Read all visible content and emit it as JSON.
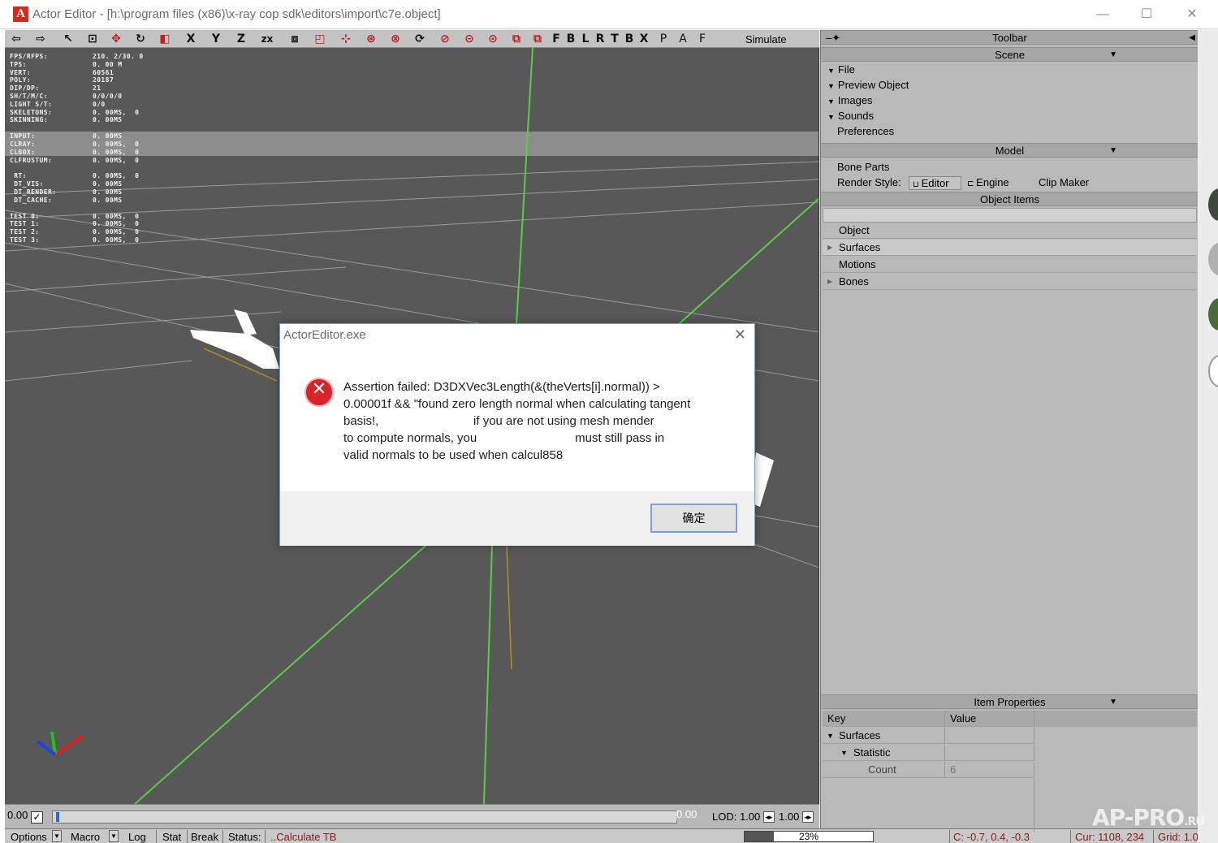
{
  "window": {
    "app_icon": "A",
    "title": "Actor Editor - [h:\\program files (x86)\\x-ray cop sdk\\editors\\import\\c7e.object]",
    "minimize": "—",
    "maximize": "☐",
    "close": "✕"
  },
  "toolbar": {
    "letters": [
      "X",
      "Y",
      "Z",
      "zx"
    ],
    "views": [
      "F",
      "B",
      "L",
      "R",
      "T",
      "B",
      "X",
      "P",
      "A",
      "F"
    ],
    "simulate": "Simulate"
  },
  "stats": [
    {
      "k": "FPS/RFPS:",
      "v": "210. 2/30. 0"
    },
    {
      "k": "TPS:",
      "v": "0. 00 M"
    },
    {
      "k": "VERT:",
      "v": "60561"
    },
    {
      "k": "POLY:",
      "v": "20187"
    },
    {
      "k": "DIP/DP:",
      "v": "21"
    },
    {
      "k": "SH/T/M/C:",
      "v": "0/0/0/0"
    },
    {
      "k": "LIGHT S/T:",
      "v": "0/0"
    },
    {
      "k": "SKELETONS:",
      "v": "0. 00MS,  0"
    },
    {
      "k": "SKINNING:",
      "v": "0. 00MS"
    },
    {
      "k": "",
      "v": "",
      "gap": true
    },
    {
      "k": "INPUT:",
      "v": "0. 00MS"
    },
    {
      "k": "CLRAY:",
      "v": "0. 00MS,  0"
    },
    {
      "k": "CLBOX:",
      "v": "0. 00MS,  0"
    },
    {
      "k": "CLFRUSTUM:",
      "v": "0. 00MS,  0"
    },
    {
      "k": "",
      "v": "",
      "gap": true
    },
    {
      "k": " RT:",
      "v": "0. 00MS,  0"
    },
    {
      "k": " DT_VIS:",
      "v": "0. 00MS"
    },
    {
      "k": " DT_RENDER:",
      "v": "0. 00MS"
    },
    {
      "k": " DT_CACHE:",
      "v": "0. 00MS"
    },
    {
      "k": "",
      "v": "",
      "gap": true
    },
    {
      "k": "TEST 0:",
      "v": "0. 00MS,  0"
    },
    {
      "k": "TEST 1:",
      "v": "0. 00MS,  0"
    },
    {
      "k": "TEST 2:",
      "v": "0. 00MS,  0"
    },
    {
      "k": "TEST 3:",
      "v": "0. 00MS,  0"
    }
  ],
  "timeline": {
    "start": "0.00",
    "end": "0.00",
    "lod_label": "LOD: 1.00",
    "lod_value2": "1.00",
    "position": 0.0
  },
  "status": {
    "options": "Options",
    "macro": "Macro",
    "log": "Log",
    "stat": "Stat",
    "break": "Break",
    "status_label": "Status:",
    "status_value": "..Calculate TB",
    "progress_text": "23%",
    "progress": 0.23,
    "cursor3d": "C: -0.7, 0.4, -0.3",
    "cursor2d": "Cur: 1108, 234",
    "grid": "Grid: 1.0"
  },
  "panel": {
    "toolbar_header": "Toolbar",
    "scene_header": "Scene",
    "scene_items": [
      "File",
      "Preview Object",
      "Images",
      "Sounds",
      "Preferences"
    ],
    "model_header": "Model",
    "bone_parts": "Bone Parts",
    "render_style_label": "Render Style:",
    "render_editor": "Editor",
    "render_engine": "Engine",
    "clip_maker": "Clip Maker",
    "object_items_header": "Object Items",
    "tree": [
      "Object",
      "Surfaces",
      "Motions",
      "Bones"
    ],
    "item_properties_header": "Item Properties",
    "prop_key": "Key",
    "prop_value": "Value",
    "prop_rows": [
      {
        "key": "Surfaces",
        "value": ""
      },
      {
        "key": "Statistic",
        "value": ""
      },
      {
        "key": "Count",
        "value": "6"
      }
    ]
  },
  "dialog": {
    "title": "ActorEditor.exe",
    "message_lines": [
      "Assertion failed: D3DXVec3Length(&(theVerts[i].normal)) >",
      "0.00001f && \"found zero length normal when calculating tangent",
      "basis!,                            if you are not using mesh mender",
      "to compute normals, you                             must still pass in",
      "valid normals to be used when calcul858"
    ],
    "ok_button": "确定",
    "close": "✕"
  },
  "watermark": {
    "main": "AP-PRO",
    "suffix": ".RU"
  },
  "colors": {
    "viewport_bg": "#585858",
    "grid_line": "#9a9a9a",
    "axis_green": "#5ccb4a",
    "error_red": "#d8232a",
    "accent_blue": "#1f6fd0"
  }
}
